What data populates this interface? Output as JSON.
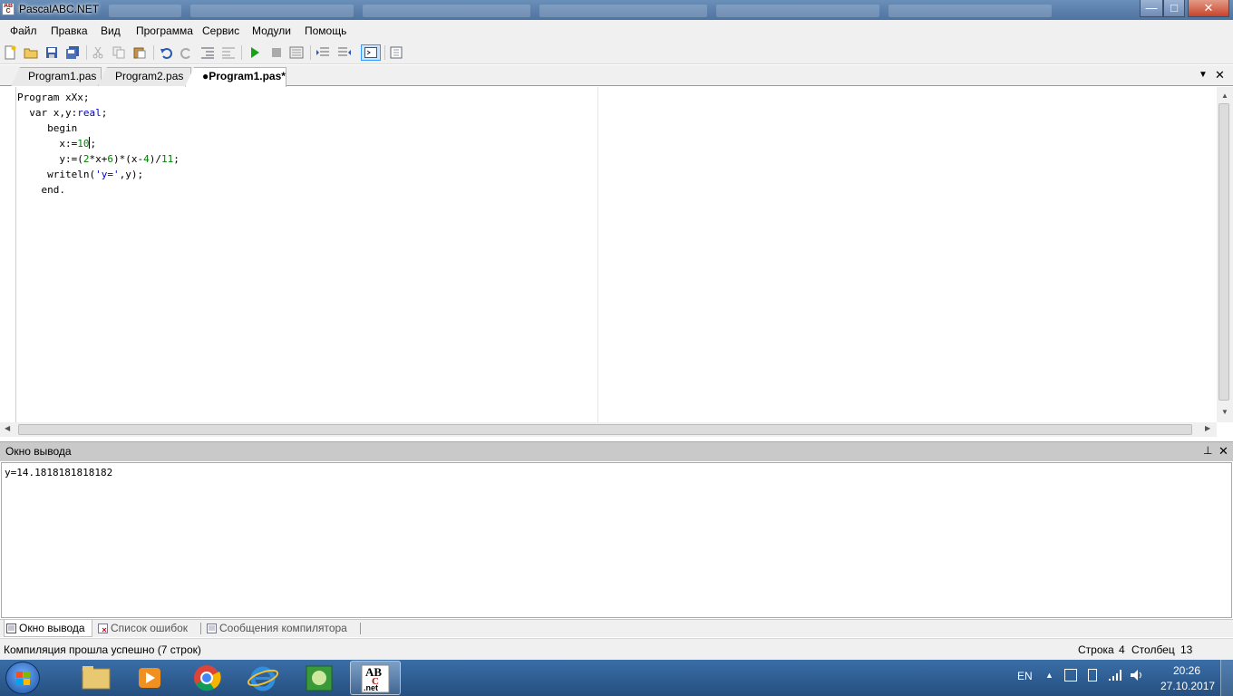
{
  "window": {
    "title": "PascalABC.NET",
    "minimize": "—",
    "maximize": "□",
    "close": "✕"
  },
  "menu": [
    "Файл",
    "Правка",
    "Вид",
    "Программа",
    "Сервис",
    "Модули",
    "Помощь"
  ],
  "tabs": [
    {
      "label": "Program1.pas",
      "active": false
    },
    {
      "label": "Program2.pas",
      "active": false
    },
    {
      "label": "●Program1.pas*",
      "active": true
    }
  ],
  "editor": {
    "lines": [
      {
        "indent": 0,
        "parts": [
          [
            "kw",
            "Program xXx;"
          ]
        ]
      },
      {
        "indent": 2,
        "parts": [
          [
            "kw",
            "var x,y:"
          ],
          [
            "ty",
            "real"
          ],
          [
            "kw",
            ";"
          ]
        ]
      },
      {
        "indent": 5,
        "parts": [
          [
            "kw",
            "begin"
          ]
        ]
      },
      {
        "indent": 7,
        "parts": [
          [
            "kw",
            "x:="
          ],
          [
            "num",
            "10"
          ],
          [
            "cursor",
            ""
          ],
          [
            "kw",
            ";"
          ]
        ]
      },
      {
        "indent": 7,
        "parts": [
          [
            "kw",
            "y:=("
          ],
          [
            "num",
            "2"
          ],
          [
            "kw",
            "*x+"
          ],
          [
            "num",
            "6"
          ],
          [
            "kw",
            ")*(x-"
          ],
          [
            "num",
            "4"
          ],
          [
            "kw",
            ")/"
          ],
          [
            "num",
            "11"
          ],
          [
            "kw",
            ";"
          ]
        ]
      },
      {
        "indent": 5,
        "parts": [
          [
            "kw",
            "writeln("
          ],
          [
            "str",
            "'y='"
          ],
          [
            "kw",
            ",y);"
          ]
        ]
      },
      {
        "indent": 4,
        "parts": [
          [
            "kw",
            "end."
          ]
        ]
      }
    ]
  },
  "output": {
    "title": "Окно вывода",
    "text": "y=14.1818181818182"
  },
  "bottom_tabs": [
    "Окно вывода",
    "Список ошибок",
    "Сообщения компилятора"
  ],
  "status": {
    "message": "Компиляция прошла успешно (7 строк)",
    "row_label": "Строка",
    "row": "4",
    "col_label": "Столбец",
    "col": "13"
  },
  "taskbar": {
    "lang": "EN",
    "time": "20:26",
    "date": "27.10.2017"
  },
  "colors": {
    "keyword_type": "#0000c0",
    "number": "#008000",
    "titlebar": "#5a7fae"
  }
}
